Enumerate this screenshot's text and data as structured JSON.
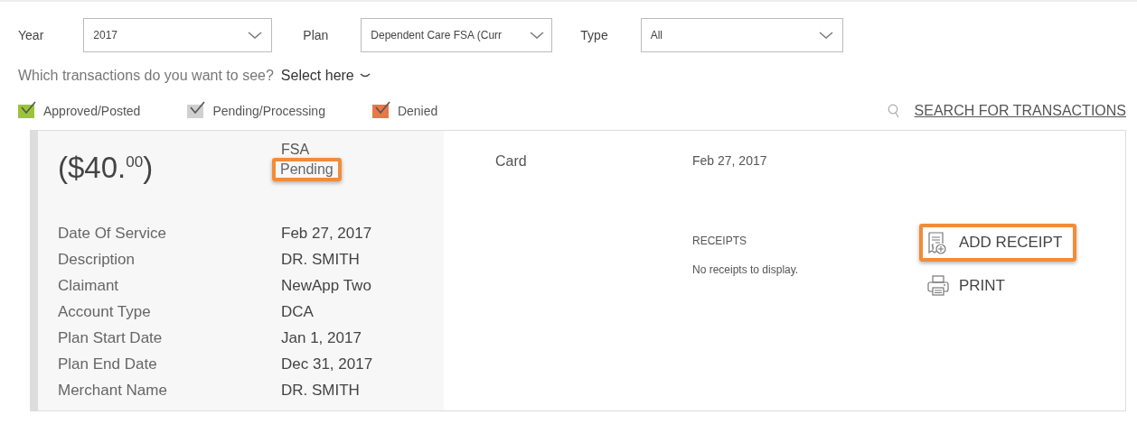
{
  "filters": [
    {
      "label": "Year",
      "value": "2017"
    },
    {
      "label": "Plan",
      "value": "Dependent Care FSA (Curr"
    },
    {
      "label": "Type",
      "value": "All"
    }
  ],
  "question": {
    "text": "Which transactions do you want to see?",
    "select": "Select here"
  },
  "legend": [
    {
      "label": "Approved/Posted",
      "checked": true,
      "color": "#9cc43a"
    },
    {
      "label": "Pending/Processing",
      "checked": true,
      "color": "#d0d0d0"
    },
    {
      "label": "Denied",
      "checked": true,
      "color": "#e8774a"
    }
  ],
  "search_link": "SEARCH FOR TRANSACTIONS",
  "transaction": {
    "amount_main": "($40.",
    "amount_cents": "00",
    "amount_close": ")",
    "plan": "FSA",
    "status": {
      "text": "Pending",
      "highlighted": true
    },
    "method": "Card",
    "date": "Feb 27, 2017",
    "details": [
      {
        "label": "Date Of Service",
        "value": "Feb 27, 2017"
      },
      {
        "label": "Description",
        "value": "DR. SMITH"
      },
      {
        "label": "Claimant",
        "value": "NewApp Two"
      },
      {
        "label": "Account Type",
        "value": "DCA"
      },
      {
        "label": "Plan Start Date",
        "value": "Jan 1, 2017"
      },
      {
        "label": "Plan End Date",
        "value": "Dec 31, 2017"
      },
      {
        "label": "Merchant Name",
        "value": "DR. SMITH"
      }
    ],
    "receipts": {
      "title": "RECEIPTS",
      "empty": "No receipts to display."
    },
    "actions": [
      {
        "kind": "receipt",
        "label": "ADD RECEIPT",
        "highlighted": true
      },
      {
        "kind": "print",
        "label": "PRINT",
        "highlighted": false
      }
    ]
  }
}
